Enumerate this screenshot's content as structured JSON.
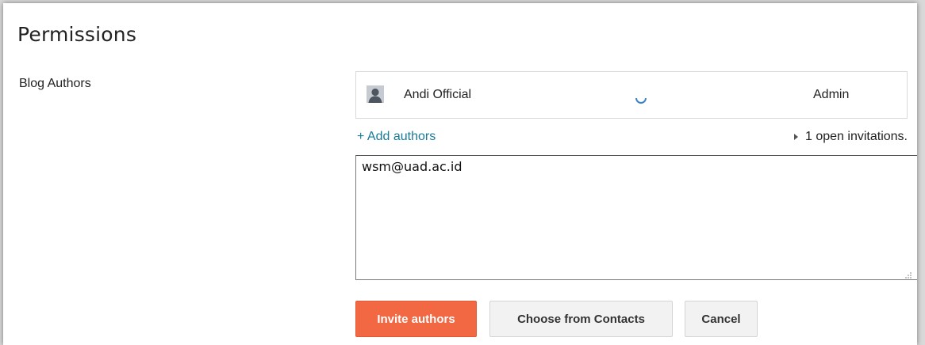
{
  "page": {
    "title": "Permissions"
  },
  "authors_section": {
    "label": "Blog Authors",
    "authors": [
      {
        "name": "Andi Official",
        "role": "Admin",
        "avatar_icon": "person-silhouette-icon"
      }
    ],
    "add_authors_link": "+ Add authors",
    "open_invitations": "1 open invitations.",
    "link_color": "#1a7a99"
  },
  "invite_form": {
    "emails_value": "wsm@uad.ac.id",
    "invite_button": "Invite authors",
    "contacts_button": "Choose from Contacts",
    "cancel_button": "Cancel",
    "primary_color": "#f26843"
  }
}
